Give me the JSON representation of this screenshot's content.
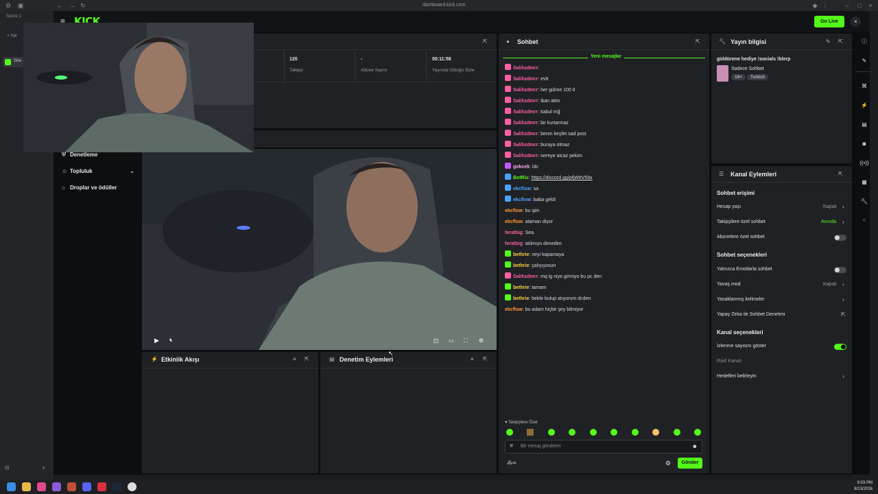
{
  "browser": {
    "url": "dashboard.kick.com",
    "space_label": "Space 1",
    "new_tab_label": "Ne",
    "tab_label": "Stre"
  },
  "app": {
    "logo": "KICK",
    "go_live": "Go Live"
  },
  "sidebar": {
    "items": [
      {
        "label": "Denetleme",
        "icon": "shield-icon"
      },
      {
        "label": "Topluluk",
        "icon": "people-icon"
      },
      {
        "label": "Droplar ve ödüller",
        "icon": "gift-icon"
      }
    ]
  },
  "stats": [
    {
      "value": "120",
      "label": "Takipçi"
    },
    {
      "value": "-",
      "label": "Abone Sayısı"
    },
    {
      "value": "00:11:58",
      "label": "Yayında Olduğu Süre"
    }
  ],
  "panels": {
    "activity": "Etkinlik Akışı",
    "moderation": "Denetim Eylemleri",
    "chat": "Sohbet",
    "stream_info": "Yayın bilgisi",
    "channel_actions": "Kanal Eylemleri"
  },
  "chat": {
    "new_messages": "Yeni mesajlar",
    "messages": [
      {
        "user": "Salihzdmrr",
        "msg": "",
        "color": "#ff5fa2",
        "badge": "#ff5fa2"
      },
      {
        "user": "Salihzdmrr",
        "msg": "evtt",
        "color": "#ff5fa2",
        "badge": "#ff5fa2"
      },
      {
        "user": "Salihzdmrr",
        "msg": "her gülme 100 tl",
        "color": "#ff5fa2",
        "badge": "#ff5fa2"
      },
      {
        "user": "Salihzdmrr",
        "msg": "iban atim",
        "color": "#ff5fa2",
        "badge": "#ff5fa2"
      },
      {
        "user": "Salihzdmrr",
        "msg": "kabul mğ",
        "color": "#ff5fa2",
        "badge": "#ff5fa2"
      },
      {
        "user": "Salihzdmrr",
        "msg": "bir kurtarmaz",
        "color": "#ff5fa2",
        "badge": "#ff5fa2"
      },
      {
        "user": "Salihzdmrr",
        "msg": "benm keşfet sad post",
        "color": "#ff5fa2",
        "badge": "#ff5fa2"
      },
      {
        "user": "Salihzdmrr",
        "msg": "buraya olmaz",
        "color": "#ff5fa2",
        "badge": "#ff5fa2"
      },
      {
        "user": "Salihzdmrr",
        "msg": "nereye atcaz pekim",
        "color": "#ff5fa2",
        "badge": "#ff5fa2"
      },
      {
        "user": "gokcek",
        "msg": "ldc",
        "color": "#f7a8f0",
        "badge": "#c45bff"
      },
      {
        "user": "BotRix",
        "msg": "https://discord.gg/pfjWttV59x",
        "color": "#53fc18",
        "badge": "#4aa3ff"
      },
      {
        "user": "ekcflow",
        "msg": "sa",
        "color": "#4aa3ff",
        "badge": "#4aa3ff"
      },
      {
        "user": "ekcflow",
        "msg": "baba geldi",
        "color": "#4aa3ff",
        "badge": "#4aa3ff"
      },
      {
        "user": "ekcflow",
        "msg": "bu qim",
        "color": "#ff9b2f",
        "badge": ""
      },
      {
        "user": "ekcflow",
        "msg": "ataman diyor",
        "color": "#ff9b2f",
        "badge": ""
      },
      {
        "user": "feratbig",
        "msg": "Sea",
        "color": "#ff5fa2",
        "badge": ""
      },
      {
        "user": "feratbig",
        "msg": "atılmıyo denedim",
        "color": "#ff5fa2",
        "badge": ""
      },
      {
        "user": "bethrie",
        "msg": "neyi kapamaya",
        "color": "#ffd23f",
        "badge": "#53fc18"
      },
      {
        "user": "bethrie",
        "msg": "çalışıyosun",
        "color": "#ffd23f",
        "badge": "#53fc18"
      },
      {
        "user": "Salihzdmrr",
        "msg": "mq ig niye girmiyo bu pc den",
        "color": "#ff5fa2",
        "badge": "#ff5fa2"
      },
      {
        "user": "bethrie",
        "msg": "tamam",
        "color": "#ffd23f",
        "badge": "#53fc18"
      },
      {
        "user": "bethrie",
        "msg": "bekle bulup atıyorum dcden",
        "color": "#ffd23f",
        "badge": "#53fc18"
      },
      {
        "user": "ekcflow",
        "msg": "bu adam hiçbir şey bilmiyor",
        "color": "#ff9b2f",
        "badge": ""
      }
    ],
    "followers_only": "Takipçilere Özel",
    "placeholder": "Bir mesaj gönderin",
    "send": "Gönder"
  },
  "stream_info": {
    "title": "güldürene hediye !socials !blerp",
    "category": "Sadece Sohbet",
    "tags": [
      "18+",
      "Turkish"
    ]
  },
  "channel_actions": {
    "sections": [
      {
        "title": "Sohbet erişimi"
      },
      {
        "title": "Sohbet seçenekleri"
      },
      {
        "title": "Kanal seçenekleri"
      }
    ],
    "rows": {
      "account_age": {
        "label": "Hesap yaşı",
        "value": "Kapalı"
      },
      "followers_only": {
        "label": "Takipçilere özel sohbet",
        "value": "Anında"
      },
      "subscribers_only": {
        "label": "Abonelere özel sohbet"
      },
      "emote_only": {
        "label": "Yalnızca Emotlarla sohbet"
      },
      "slow_mode": {
        "label": "Yavaş mod",
        "value": "Kapalı"
      },
      "banned_words": {
        "label": "Yasaklanmış kelimeler"
      },
      "ai_moderation": {
        "label": "Yapay Zeka ile Sohbet Denetimi"
      },
      "show_viewers": {
        "label": "İzlenme sayısını göster"
      },
      "raid_channel": {
        "label": "Raid Kanalı"
      },
      "set_goals": {
        "label": "Hedefleri belirleyin"
      }
    }
  },
  "taskbar": {
    "time": "9:03 PM",
    "date": "8/13/2026"
  },
  "colors": {
    "brand": "#53fc18",
    "panel": "#1f2124",
    "background": "#0d0e10"
  }
}
